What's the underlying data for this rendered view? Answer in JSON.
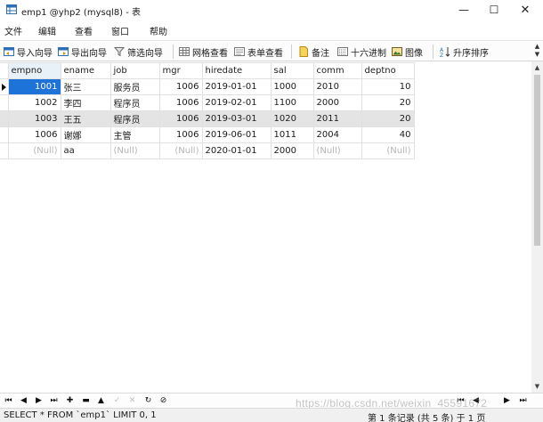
{
  "window": {
    "title": "emp1 @yhp2 (mysql8) - 表",
    "minimize": "—",
    "maximize": "☐",
    "close": "✕"
  },
  "menu": {
    "items": [
      "文件",
      "编辑",
      "查看",
      "窗口",
      "帮助"
    ]
  },
  "toolbar": {
    "import_wizard": "导入向导",
    "export_wizard": "导出向导",
    "filter_wizard": "筛选向导",
    "grid_view": "网格查看",
    "form_view": "表单查看",
    "memo": "备注",
    "hex": "十六进制",
    "image": "图像",
    "sort_asc": "升序排序"
  },
  "grid": {
    "columns": [
      "empno",
      "ename",
      "job",
      "mgr",
      "hiredate",
      "sal",
      "comm",
      "deptno"
    ],
    "rows": [
      [
        "1001",
        "张三",
        "服务员",
        "1006",
        "2019-01-01",
        "1000",
        "2010",
        "10"
      ],
      [
        "1002",
        "李四",
        "程序员",
        "1006",
        "2019-02-01",
        "1100",
        "2000",
        "20"
      ],
      [
        "1003",
        "王五",
        "程序员",
        "1006",
        "2019-03-01",
        "1020",
        "2011",
        "20"
      ],
      [
        "1006",
        "谢娜",
        "主管",
        "1006",
        "2019-06-01",
        "1011",
        "2004",
        "40"
      ],
      [
        "(Null)",
        "aa",
        "(Null)",
        "(Null)",
        "2020-01-01",
        "2000",
        "(Null)",
        "(Null)"
      ]
    ],
    "current_row": 0,
    "selected_row": 2
  },
  "status": {
    "sql": "SELECT * FROM `emp1` LIMIT 0, 1",
    "record_info": "第 1 条记录 (共 5 条) 于 1 页"
  },
  "watermark": "https://blog.csdn.net/weixin_45591672",
  "colors": {
    "active_cell": "#1e73d8",
    "selected_row": "#e4e4e4",
    "null_text": "#b5b5b5"
  }
}
